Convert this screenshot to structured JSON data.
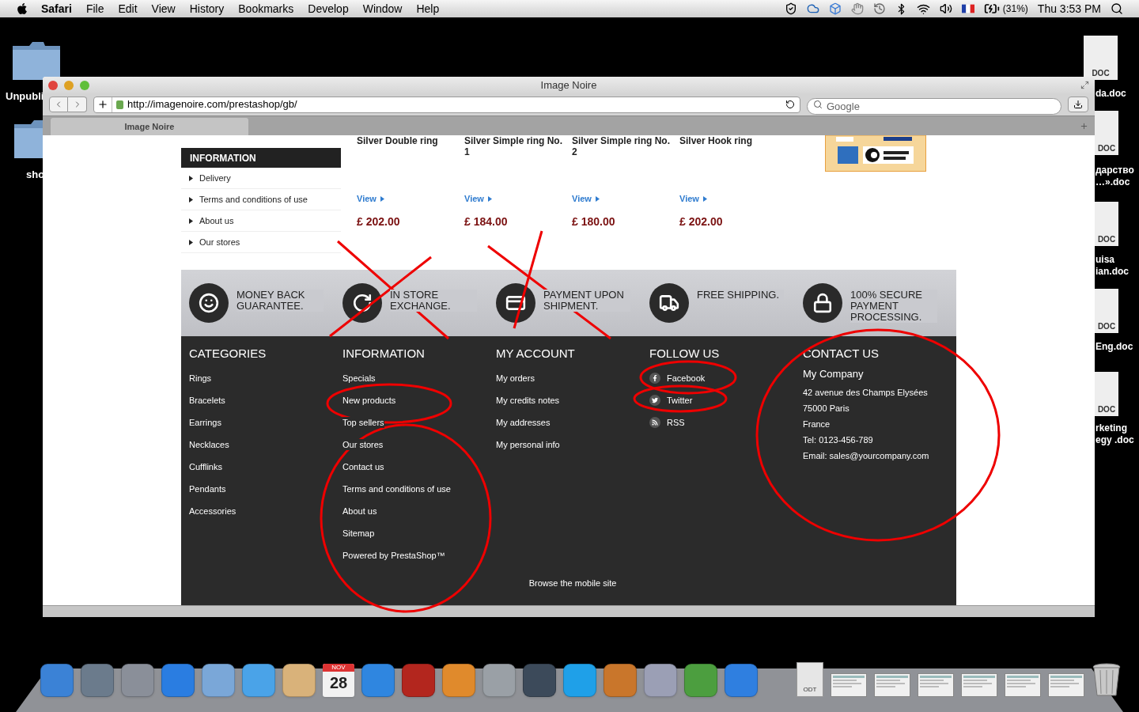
{
  "menu_bar": {
    "app": "Safari",
    "menus": [
      "File",
      "Edit",
      "View",
      "History",
      "Bookmarks",
      "Develop",
      "Window",
      "Help"
    ],
    "battery": "(31%)",
    "clock": "Thu 3:53 PM"
  },
  "desktop_left": [
    {
      "label": "Unpubli"
    },
    {
      "label": "sho"
    }
  ],
  "desktop_right": [
    {
      "type": "DOC",
      "lines": [
        "da.doc"
      ]
    },
    {
      "type": "DOC",
      "lines": [
        "дарство",
        "…».doc"
      ]
    },
    {
      "type": "DOC",
      "lines": [
        "uisa",
        "ian.doc"
      ]
    },
    {
      "type": "DOC",
      "lines": [
        "Eng.doc"
      ]
    },
    {
      "type": "DOC",
      "lines": [
        "rketing",
        "egy .doc"
      ]
    }
  ],
  "window": {
    "title": "Image Noire",
    "url": "http://imagenoire.com/prestashop/gb/",
    "search_placeholder": "Google",
    "tabs": [
      {
        "label": "Image Noire",
        "selected": true
      }
    ]
  },
  "sidebar": {
    "title": "INFORMATION",
    "items": [
      "Delivery",
      "Terms and conditions of use",
      "About us",
      "Our stores"
    ]
  },
  "products": [
    {
      "name": "Silver Double ring",
      "link": "View",
      "price": "£ 202.00"
    },
    {
      "name": "Silver Simple ring No. 1",
      "link": "View",
      "price": "£ 184.00"
    },
    {
      "name": "Silver Simple ring No. 2",
      "link": "View",
      "price": "£ 180.00"
    },
    {
      "name": "Silver Hook ring",
      "link": "View",
      "price": "£ 202.00"
    }
  ],
  "services": [
    {
      "kind": "smile",
      "label": "MONEY BACK GUARANTEE."
    },
    {
      "kind": "exchange",
      "label": "IN STORE EXCHANGE."
    },
    {
      "kind": "card",
      "label": "PAYMENT UPON SHIPMENT."
    },
    {
      "kind": "truck",
      "label": "FREE SHIPPING."
    },
    {
      "kind": "lock",
      "label": "100% SECURE PAYMENT PROCESSING."
    }
  ],
  "footer": {
    "categories": {
      "title": "CATEGORIES",
      "items": [
        "Rings",
        "Bracelets",
        "Earrings",
        "Necklaces",
        "Cufflinks",
        "Pendants",
        "Accessories"
      ]
    },
    "information": {
      "title": "INFORMATION",
      "items": [
        "Specials",
        "New products",
        "Top sellers",
        "Our stores",
        "Contact us",
        "Terms and conditions of use",
        "About us",
        "Sitemap",
        "Powered by PrestaShop™"
      ]
    },
    "account": {
      "title": "MY ACCOUNT",
      "items": [
        "My orders",
        "My credits notes",
        "My addresses",
        "My personal info"
      ]
    },
    "follow": {
      "title": "FOLLOW US",
      "items": [
        {
          "kind": "facebook",
          "label": "Facebook"
        },
        {
          "kind": "twitter",
          "label": "Twitter"
        },
        {
          "kind": "rss",
          "label": "RSS"
        }
      ]
    },
    "contact": {
      "title": "CONTACT US",
      "company": "My Company",
      "lines": [
        "42 avenue des Champs Elysées",
        "75000 Paris",
        "France",
        "Tel: 0123-456-789",
        "Email: sales@yourcompany.com"
      ]
    },
    "mobile_link": "Browse the mobile site"
  },
  "dock": [
    {
      "kind": "app",
      "color": "#3b82d6"
    },
    {
      "kind": "app",
      "color": "#6b7b8c"
    },
    {
      "kind": "app",
      "color": "#8a8f99"
    },
    {
      "kind": "app",
      "color": "#2a7de1"
    },
    {
      "kind": "app",
      "color": "#7aa7d8"
    },
    {
      "kind": "app",
      "color": "#4aa3e8"
    },
    {
      "kind": "app",
      "color": "#d9b27a"
    },
    {
      "kind": "calendar",
      "color": "#f2f2f2",
      "month": "NOV",
      "day": "28"
    },
    {
      "kind": "app",
      "color": "#2f86e0"
    },
    {
      "kind": "app",
      "color": "#b3261e"
    },
    {
      "kind": "app",
      "color": "#e08a2c"
    },
    {
      "kind": "app",
      "color": "#9aa0a6"
    },
    {
      "kind": "app",
      "color": "#3c4a5a"
    },
    {
      "kind": "app",
      "color": "#1fa0e8"
    },
    {
      "kind": "app",
      "color": "#c9762b"
    },
    {
      "kind": "app",
      "color": "#9b9fb5"
    },
    {
      "kind": "app",
      "color": "#4c9e3f"
    },
    {
      "kind": "app",
      "color": "#2f7fe0"
    },
    {
      "kind": "document",
      "color": "#e6e6e6",
      "type": "ODT"
    },
    {
      "kind": "window",
      "color": "#f0f0f0"
    },
    {
      "kind": "window",
      "color": "#f0f0f0"
    },
    {
      "kind": "window",
      "color": "#f0f0f0"
    },
    {
      "kind": "window",
      "color": "#f0f0f0"
    },
    {
      "kind": "window",
      "color": "#f0f0f0"
    },
    {
      "kind": "window",
      "color": "#f0f0f0"
    },
    {
      "kind": "trash",
      "color": "#c8c8c8"
    }
  ]
}
